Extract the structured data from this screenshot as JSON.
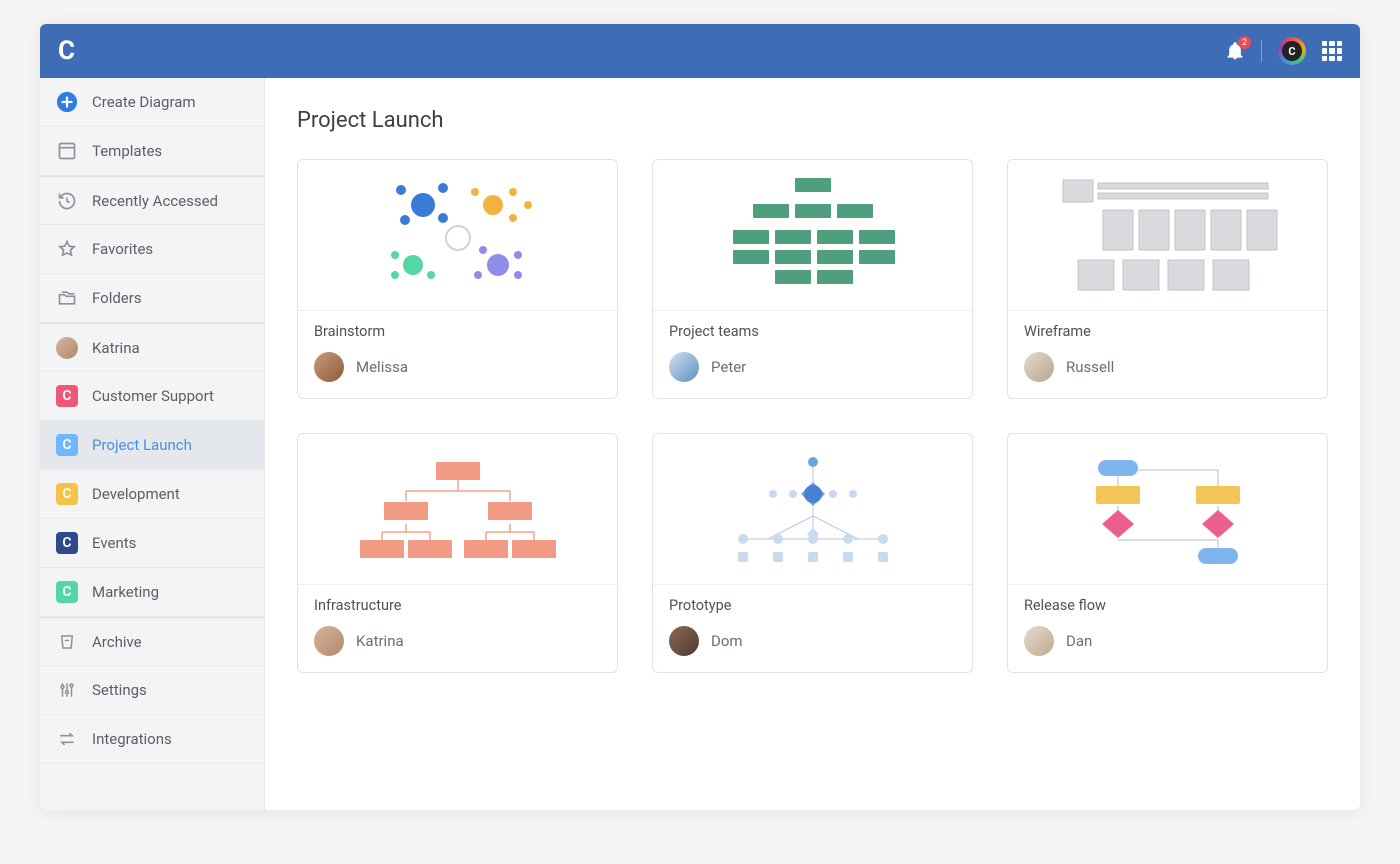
{
  "header": {
    "notification_count": "2",
    "avatar_letter": "C"
  },
  "sidebar": {
    "create": "Create Diagram",
    "templates": "Templates",
    "recent": "Recently Accessed",
    "favorites": "Favorites",
    "folders": "Folders",
    "user": "Katrina",
    "spaces": [
      {
        "label": "Customer Support",
        "color": "#ef5777",
        "active": false
      },
      {
        "label": "Project Launch",
        "color": "#6fb7ff",
        "active": true
      },
      {
        "label": "Development",
        "color": "#f6c344",
        "active": false
      },
      {
        "label": "Events",
        "color": "#2e4a8a",
        "active": false
      },
      {
        "label": "Marketing",
        "color": "#55d6a5",
        "active": false
      }
    ],
    "archive": "Archive",
    "settings": "Settings",
    "integrations": "Integrations"
  },
  "page": {
    "title": "Project Launch",
    "cards": [
      {
        "title": "Brainstorm",
        "owner": "Melissa",
        "av": [
          "#c79b7b",
          "#8e5a3b"
        ]
      },
      {
        "title": "Project teams",
        "owner": "Peter",
        "av": [
          "#cfe0ef",
          "#5f8fbf"
        ]
      },
      {
        "title": "Wireframe",
        "owner": "Russell",
        "av": [
          "#e4d8cf",
          "#b8a58f"
        ]
      },
      {
        "title": "Infrastructure",
        "owner": "Katrina",
        "av": [
          "#d7b49e",
          "#b08968"
        ]
      },
      {
        "title": "Prototype",
        "owner": "Dom",
        "av": [
          "#8a6b55",
          "#4d3a2c"
        ]
      },
      {
        "title": "Release flow",
        "owner": "Dan",
        "av": [
          "#e7dbcf",
          "#bda88e"
        ]
      }
    ]
  },
  "colors": {
    "header": "#3e6db5",
    "accent": "#4a90e2"
  }
}
